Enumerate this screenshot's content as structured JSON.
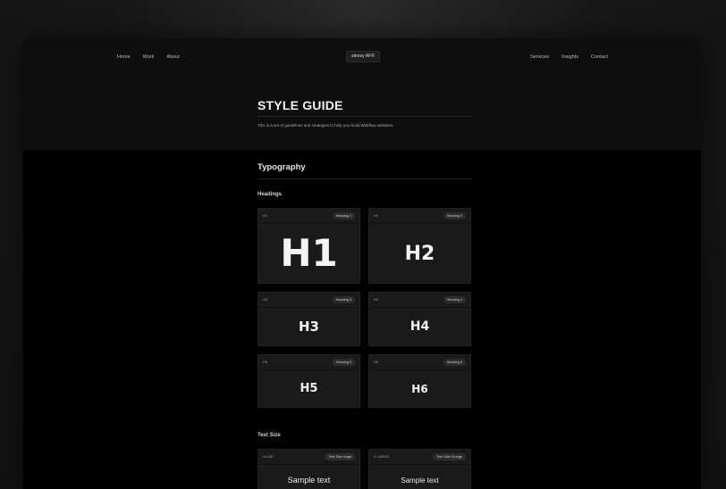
{
  "nav": {
    "left": [
      "Home",
      "Work",
      "About"
    ],
    "right": [
      "Services",
      "Insights",
      "Contact"
    ],
    "logo": "steezy AF®"
  },
  "hero": {
    "title": "STYLE GUIDE",
    "subtitle": "This is a set of guidelines and strategies to help you build Webflow websites."
  },
  "typography": {
    "title": "Typography",
    "headings_label": "Headings",
    "headings": [
      {
        "tag": "H1",
        "badge": "Heading 1",
        "display": "H1"
      },
      {
        "tag": "H2",
        "badge": "Heading 2",
        "display": "H2"
      },
      {
        "tag": "H3",
        "badge": "Heading 3",
        "display": "H3"
      },
      {
        "tag": "H4",
        "badge": "Heading 4",
        "display": "H4"
      },
      {
        "tag": "H5",
        "badge": "Heading 5",
        "display": "H5"
      },
      {
        "tag": "H6",
        "badge": "Heading 6",
        "display": "H6"
      }
    ],
    "text_size_label": "Text Size",
    "text_sizes": [
      {
        "tag": "HUGE",
        "badge": "Text Size Huge",
        "sample": "Sample text"
      },
      {
        "tag": "X LARGE",
        "badge": "Text Size XLarge",
        "sample": "Sample text"
      }
    ]
  }
}
